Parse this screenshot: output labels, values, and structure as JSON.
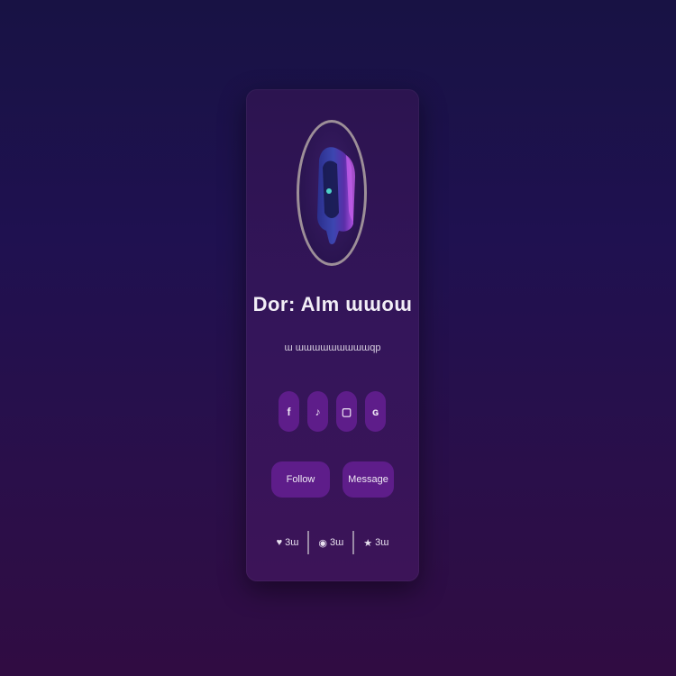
{
  "profile": {
    "name": "Dor: Alm ɯɯoɯ",
    "tagline": "ɯ ɯɯɯɯɯɯɯɯɯqp",
    "avatar_icon": "hooded-figure-icon"
  },
  "socials": [
    {
      "icon": "facebook-icon",
      "glyph": "f"
    },
    {
      "icon": "tiktok-icon",
      "glyph": "♪"
    },
    {
      "icon": "instagram-icon",
      "glyph": "▢"
    },
    {
      "icon": "github-icon",
      "glyph": "ɢ"
    }
  ],
  "actions": {
    "follow_label": "Follow",
    "message_label": "Message"
  },
  "stats": [
    {
      "icon": "heart-icon",
      "glyph": "♥",
      "value": "3ɯ"
    },
    {
      "icon": "eye-icon",
      "glyph": "◉",
      "value": "3ɯ"
    },
    {
      "icon": "star-icon",
      "glyph": "★",
      "value": "3ɯ"
    }
  ],
  "colors": {
    "background_top": "#181244",
    "background_bottom": "#300c42",
    "card": "#34155a",
    "button": "#5e1d8a",
    "avatar_border": "#9d8f98"
  }
}
